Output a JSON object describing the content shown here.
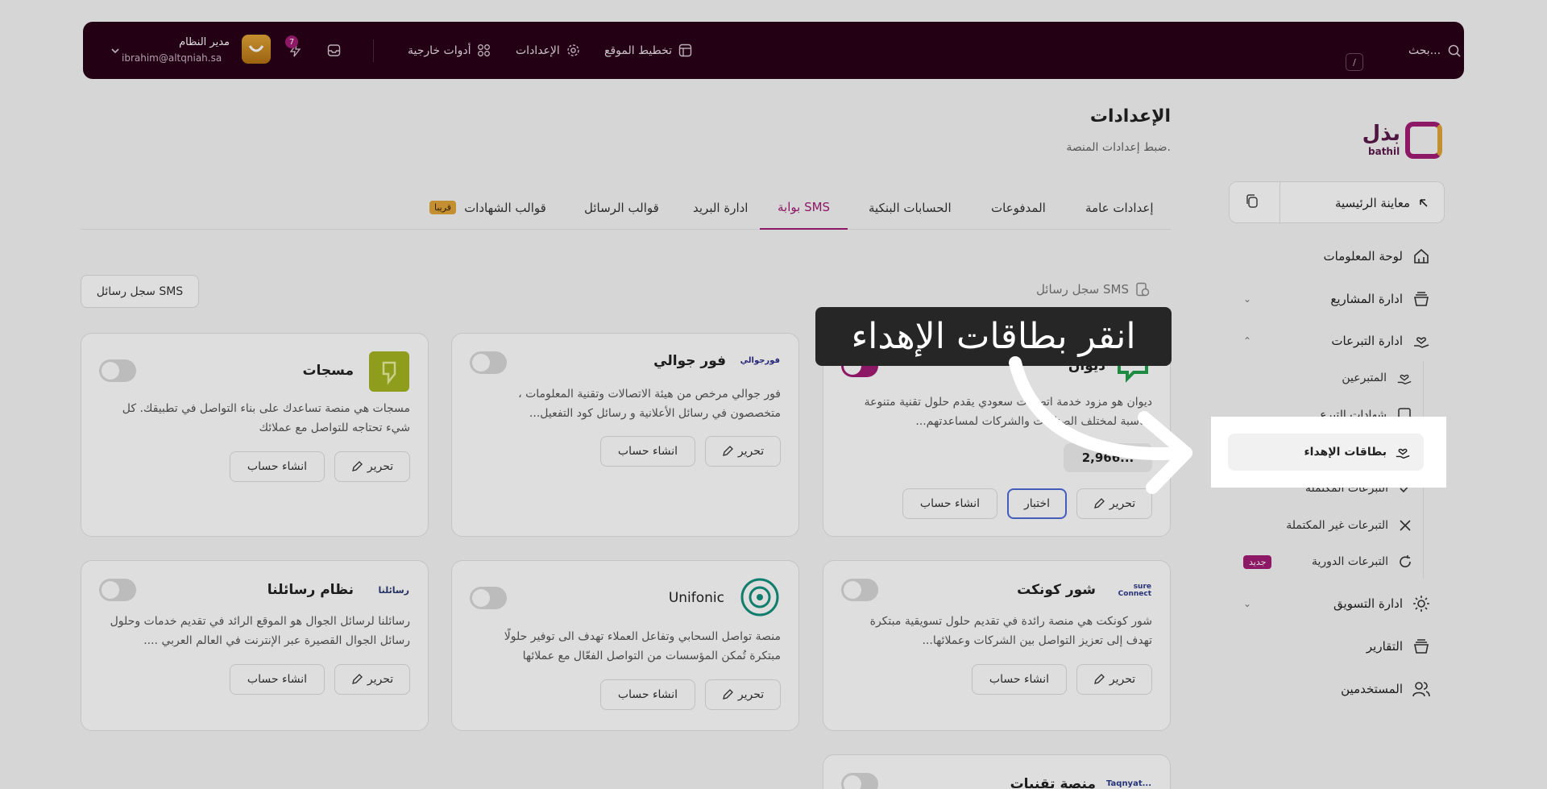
{
  "topbar": {
    "search_placeholder": "بحث...",
    "search_shortcut": "/",
    "nav": [
      "تخطيط الموقع",
      "الإعدادات",
      "أدوات خارجية"
    ],
    "notif_count": "7",
    "user_name": "مدير النظام",
    "user_email": "ibrahim@altqniah.sa"
  },
  "page": {
    "title": "الإعدادات",
    "subtitle": "ضبط إعدادات المنصة."
  },
  "tabs": [
    "إعدادات عامة",
    "المدفوعات",
    "الحسابات البنكية",
    "بوابة SMS",
    "ادارة البريد",
    "قوالب الرسائل",
    "قوالب الشهادات"
  ],
  "tabs_active_index": 3,
  "soon_badge": "قريبا",
  "log": {
    "title": "سجل رسائل SMS",
    "button": "سجل رسائل SMS"
  },
  "providers": [
    {
      "name": "ديوان",
      "desc": "ديوان هو مزود خدمة اتصالات سعودي يقدم حلول تقنية متنوعة مناسبة لمختلف الصناعات والشركات لمساعدتهم...",
      "balance": "2,966...",
      "edit": "تحرير",
      "test": "اختبار",
      "create": "انشاء حساب",
      "enabled": true
    },
    {
      "name": "فور جوالي",
      "logo_text": "فورجوالي",
      "desc": "فور جوالي مرخص من هيئة الاتصالات وتقنية المعلومات ، متخصصون في رسائل الأعلانية و رسائل كود التفعيل...",
      "edit": "تحرير",
      "create": "انشاء حساب",
      "enabled": false
    },
    {
      "name": "مسجات",
      "desc": "مسجات هي منصة تساعدك على بناء التواصل في تطبيقك. كل شيء تحتاجه للتواصل مع عملائك",
      "edit": "تحرير",
      "create": "انشاء حساب",
      "enabled": false
    },
    {
      "name": "شور كونكت",
      "logo_text": "sure Connect",
      "desc": "شور كونكت هي منصة رائدة في تقديم حلول تسويقية مبتكرة تهدف إلى تعزيز التواصل بين الشركات وعملائها...",
      "edit": "تحرير",
      "create": "انشاء حساب",
      "enabled": false
    },
    {
      "name": "Unifonic",
      "desc": "منصة تواصل السحابي وتفاعل العملاء تهدف الى توفير حلولًا مبتكرة تُمكن المؤسسات من التواصل الفعّال مع عملائها",
      "edit": "تحرير",
      "create": "انشاء حساب",
      "enabled": false
    },
    {
      "name": "نظام رسائلنا",
      "logo_text": "رسائلنا",
      "desc": "رسائلنا لرسائل الجوال هو الموقع الرائد في تقديم خدمات وحلول رسائل الجوال القصيرة عبر الإنترنت في العالم العربي ....",
      "edit": "تحرير",
      "create": "انشاء حساب",
      "enabled": false
    },
    {
      "name": "منصة تقنيات",
      "logo_text": "Taqnyat...",
      "enabled": false
    }
  ],
  "sidebar": {
    "logo_text": "بذل",
    "logo_sub": "bathil",
    "preview": "معاينة الرئيسية",
    "items": [
      {
        "label": "لوحة المعلومات"
      },
      {
        "label": "ادارة المشاريع"
      },
      {
        "label": "ادارة التبرعات"
      },
      {
        "label": "المتبرعين"
      },
      {
        "label": "شهادات التبرع"
      },
      {
        "label": "بطاقات الإهداء"
      },
      {
        "label": "التبرعات المكتملة"
      },
      {
        "label": "التبرعات غير المكتملة"
      },
      {
        "label": "التبرعات الدورية",
        "badge": "جديد"
      },
      {
        "label": "ادارة التسويق"
      },
      {
        "label": "التقارير"
      },
      {
        "label": "المستخدمين"
      }
    ]
  },
  "tooltip": {
    "text": "انقر بطاقات الإهداء"
  },
  "colors": {
    "brand": "#a21c74",
    "topbar": "#2a0019",
    "accent_gold": "#e1a538"
  }
}
